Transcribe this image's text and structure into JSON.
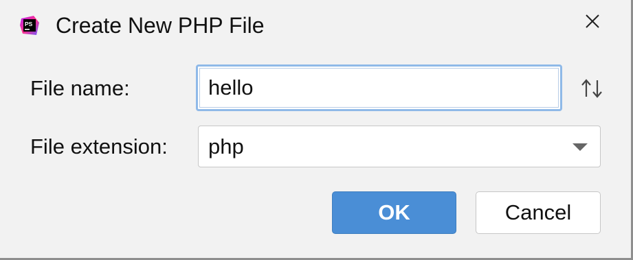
{
  "window": {
    "title": "Create New PHP File",
    "app_icon": "phpstorm-icon",
    "app_icon_text": "PS",
    "close_icon": "close-icon"
  },
  "form": {
    "file_name_label": "File name:",
    "file_name_value": "hello",
    "sort_icon": "sort-up-down-icon",
    "file_extension_label": "File extension:",
    "file_extension_value": "php"
  },
  "buttons": {
    "ok_label": "OK",
    "cancel_label": "Cancel"
  },
  "colors": {
    "accent": "#4a8ed6",
    "focus_border": "#8fb9e8",
    "dialog_bg": "#f2f2f2"
  }
}
